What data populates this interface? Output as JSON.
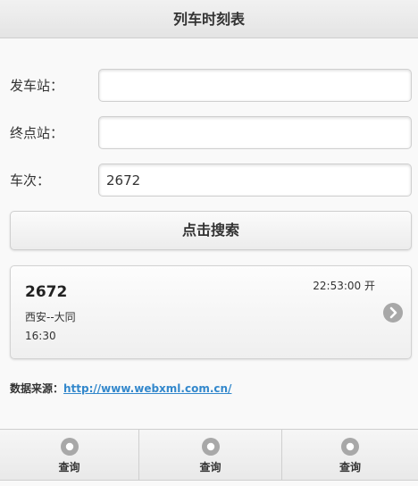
{
  "header": {
    "title": "列车时刻表"
  },
  "form": {
    "from": {
      "label": "发车站：",
      "value": ""
    },
    "to": {
      "label": "终点站：",
      "value": ""
    },
    "train": {
      "label": "车次：",
      "value": "2672"
    },
    "search_label": "点击搜索"
  },
  "results": [
    {
      "train_no": "2672",
      "route": "西安--大同",
      "arrive_time": "16:30",
      "depart": "22:53:00 开"
    }
  ],
  "source": {
    "label": "数据来源：",
    "link": "http://www.webxml.com.cn/"
  },
  "footer": {
    "tabs": [
      {
        "label": "查询",
        "icon": "circle-icon"
      },
      {
        "label": "查询",
        "icon": "circle-icon"
      },
      {
        "label": "查询",
        "icon": "circle-icon"
      }
    ]
  },
  "colors": {
    "link": "#3388cc",
    "icon": "#a8a8a8"
  }
}
